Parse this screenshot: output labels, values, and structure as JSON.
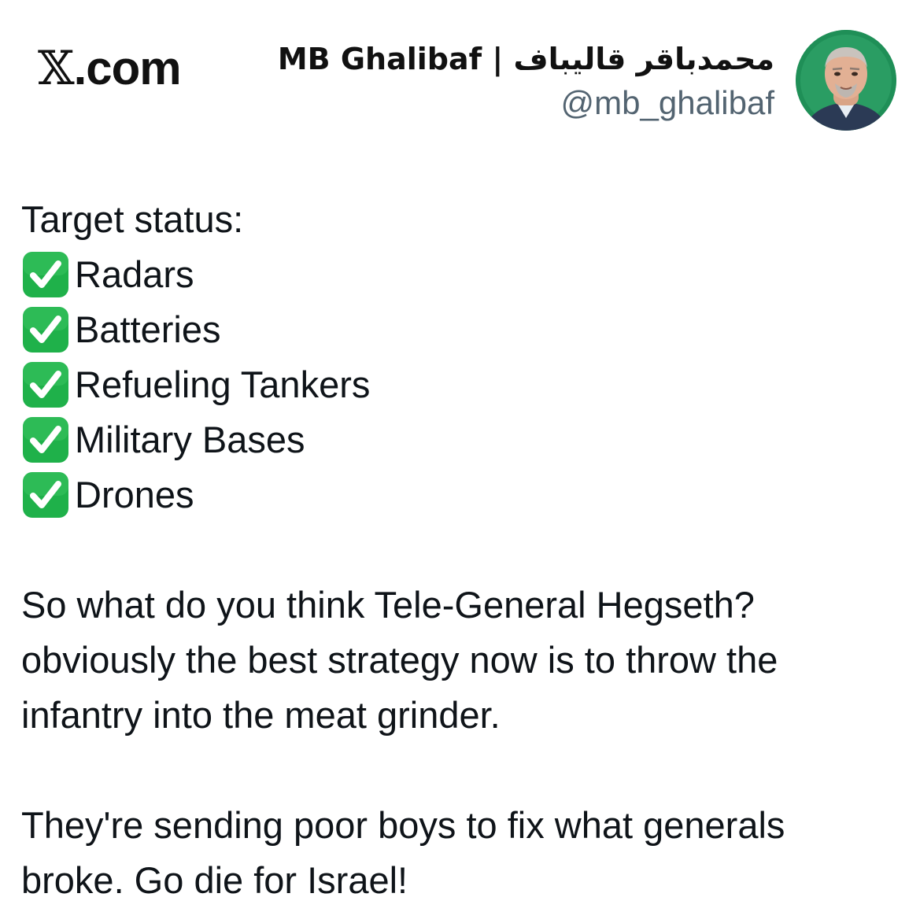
{
  "header": {
    "brand": "X.com",
    "author_name": "محمدباقر قالیباف | MB Ghalibaf",
    "handle": "@mb_ghalibaf",
    "avatar_icon": "profile-photo"
  },
  "tweet": {
    "heading": "Target status:",
    "checklist_icon": "check-mark-button-emoji",
    "checklist": [
      {
        "label": "Radars"
      },
      {
        "label": "Batteries"
      },
      {
        "label": "Refueling Tankers"
      },
      {
        "label": "Military Bases"
      },
      {
        "label": "Drones"
      }
    ],
    "paragraph1": [
      "So what do you think Tele-General Hegseth?",
      "obviously the best strategy now is to throw the",
      "infantry into the meat grinder."
    ],
    "paragraph2": [
      "They're sending poor boys to fix what generals",
      "broke. Go die for Israel!"
    ]
  },
  "colors": {
    "text": "#0f1419",
    "handle": "#536471",
    "check_green": "#1fb14a",
    "avatar_ring": "#1f8f57"
  }
}
